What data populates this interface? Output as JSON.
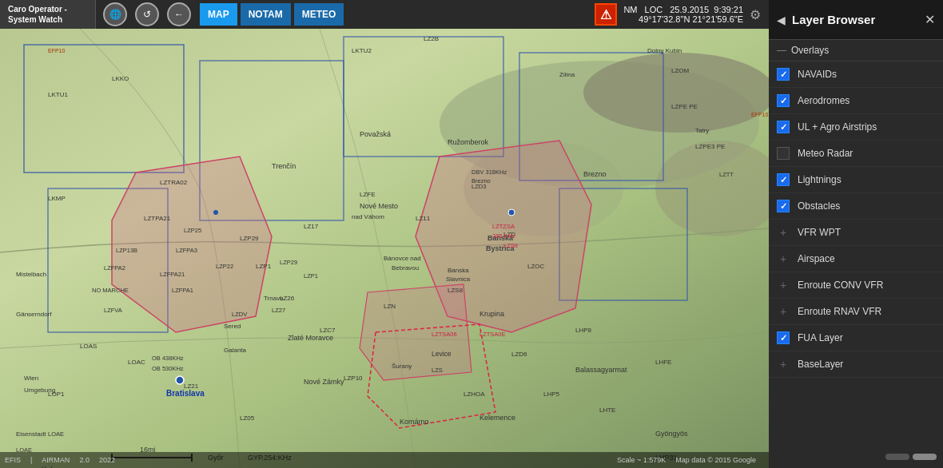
{
  "app": {
    "title_line1": "Caro Operator -",
    "title_line2": "System Watch"
  },
  "topbar": {
    "nav_buttons": [
      "MAP",
      "NOTAM",
      "METEO"
    ],
    "active_nav": "MAP",
    "date": "25.9.2015",
    "time": "9:39:21",
    "nm_label": "NM",
    "loc_label": "LOC",
    "coordinates": "49°17'32.8\"N 21°21'59.6\"E",
    "warning_symbol": "⚠",
    "gear_symbol": "⚙"
  },
  "layer_browser": {
    "title": "Layer Browser",
    "collapse_icon": "◀",
    "close_icon": "✕",
    "sections": [
      {
        "type": "header",
        "label": "Overlays",
        "icon": "—"
      },
      {
        "type": "item",
        "label": "NAVAIDs",
        "checked": true,
        "has_plus": false
      },
      {
        "type": "item",
        "label": "Aerodromes",
        "checked": true,
        "has_plus": false
      },
      {
        "type": "item",
        "label": "UL + Agro Airstrips",
        "checked": true,
        "has_plus": false
      },
      {
        "type": "item",
        "label": "Meteo Radar",
        "checked": false,
        "has_plus": false
      },
      {
        "type": "item",
        "label": "Lightnings",
        "checked": true,
        "has_plus": false
      },
      {
        "type": "item",
        "label": "Obstacles",
        "checked": true,
        "has_plus": false
      },
      {
        "type": "item",
        "label": "VFR WPT",
        "checked": false,
        "has_plus": true
      },
      {
        "type": "item",
        "label": "Airspace",
        "checked": false,
        "has_plus": true
      },
      {
        "type": "item",
        "label": "Enroute CONV VFR",
        "checked": false,
        "has_plus": true
      },
      {
        "type": "item",
        "label": "Enroute RNAV VFR",
        "checked": false,
        "has_plus": true
      },
      {
        "type": "item",
        "label": "FUA Layer",
        "checked": true,
        "has_plus": false
      },
      {
        "type": "item",
        "label": "BaseLayer",
        "checked": false,
        "has_plus": true
      }
    ]
  },
  "map": {
    "scale": "Scale ~ 1:579K",
    "copyright": "Map data © 2015 Google"
  },
  "bottom_bar": {
    "items": [
      "EFIS",
      "AIRMAN",
      "2.0",
      "2022"
    ]
  }
}
